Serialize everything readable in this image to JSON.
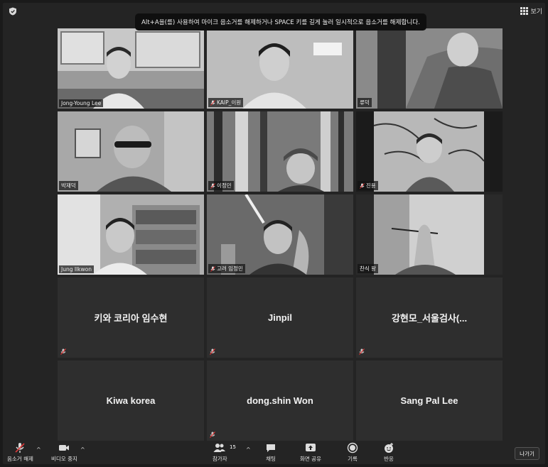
{
  "banner": {
    "text": "Alt+A을(를) 사용하여 마이크 음소거를 해제하거나 SPACE 키를 길게 눌러 일시적으로 음소거를 해제합니다."
  },
  "view_button": {
    "label": "보기"
  },
  "participants_video": [
    {
      "name": "Jong-Young Lee",
      "muted": false,
      "active": true
    },
    {
      "name": "KAIP_이원",
      "muted": true,
      "active": false
    },
    {
      "name": "류덕",
      "muted": false,
      "active": false
    },
    {
      "name": "박재덕",
      "muted": false,
      "active": false
    },
    {
      "name": "이정민",
      "muted": true,
      "active": false
    },
    {
      "name": "진용",
      "muted": true,
      "active": false
    },
    {
      "name": "Jung Ilkwon",
      "muted": false,
      "active": false
    },
    {
      "name": "고려 임정민",
      "muted": true,
      "active": false
    },
    {
      "name": "찬식 왕",
      "muted": false,
      "active": false
    }
  ],
  "participants_no_video": [
    {
      "name": "키와 코리아 임수현",
      "muted": true
    },
    {
      "name": "Jinpil",
      "muted": true
    },
    {
      "name": "강현모_서울검사(...",
      "muted": true
    },
    {
      "name": "Kiwa korea",
      "muted": false
    },
    {
      "name": "dong.shin Won",
      "muted": true
    },
    {
      "name": "Sang Pal Lee",
      "muted": false
    }
  ],
  "toolbar": {
    "unmute": "음소거 해제",
    "stop_video": "비디오 중지",
    "participants": "참가자",
    "participants_count": "15",
    "chat": "채팅",
    "share_screen": "화면 공유",
    "record": "기록",
    "reactions": "반응",
    "leave": "나가기"
  }
}
